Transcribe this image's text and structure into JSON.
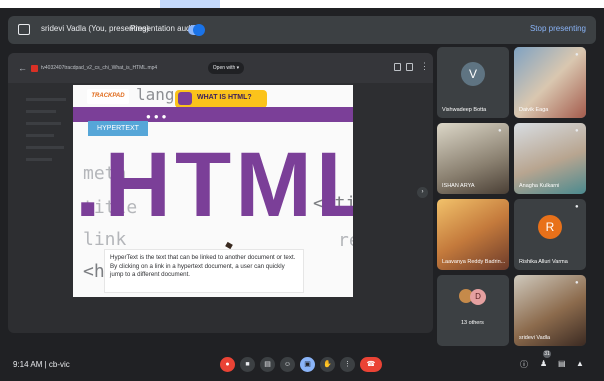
{
  "presentation_bar": {
    "presenter": "sridevi Vadla (You, presenting)",
    "audio_label": "Presentation audio",
    "stop_label": "Stop presenting"
  },
  "viewer": {
    "file_name": "tv4032407tracdpad_v2_cs_chi_What_is_HTML.mp4",
    "open_with": "Open with"
  },
  "slide": {
    "logo": "TRACKPAD",
    "title_badge": "WHAT IS HTML?",
    "code_top": "lang",
    "tab_label": "HYPERTEXT",
    "big_text": ".HTML",
    "code_meta": "meta",
    "code_title": "title",
    "code_link": "link",
    "code_h": "<h",
    "code_close_ti": "</ti",
    "code_re": "re",
    "description": "HyperText is the text that can be linked to another document or text. By clicking on a link in a hypertext document, a user can quickly jump to a different document."
  },
  "participants": [
    {
      "name": "Vishwadeep Botta",
      "initial": "V",
      "color": "#5f7482"
    },
    {
      "name": "Daivik Eaga"
    },
    {
      "name": "ISHAN ARYA"
    },
    {
      "name": "Anagha Kulkarni"
    },
    {
      "name": "Laavanya Reddy Badrin..."
    },
    {
      "name": "Rishika Alluri Varma",
      "initial": "R",
      "color": "#e8711a"
    },
    {
      "name": "13 others",
      "initial": "D"
    },
    {
      "name": "sridevi Vadla"
    }
  ],
  "bottom": {
    "time": "9:14 AM",
    "separator": "|",
    "meeting_code": "cb-vic",
    "people_count": "31"
  }
}
